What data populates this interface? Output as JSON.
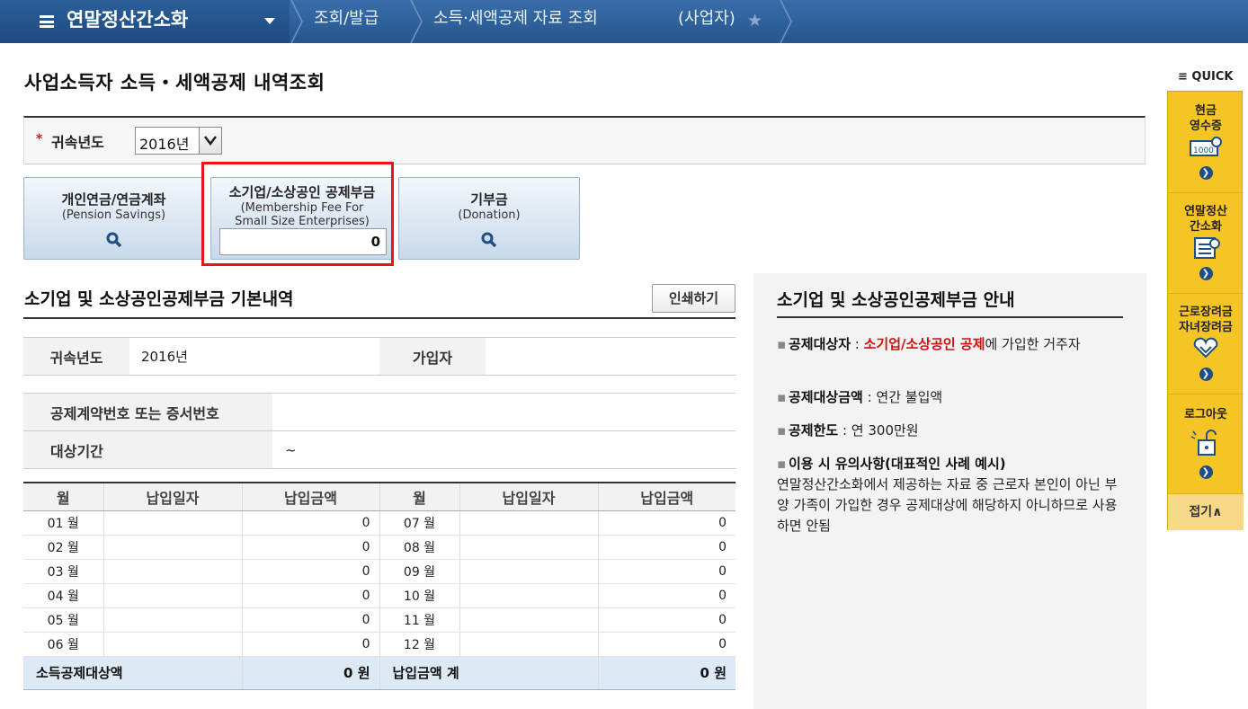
{
  "topbar": {
    "app_title": "연말정산간소화",
    "breadcrumbs": [
      "조회/발급",
      "소득·세액공제 자료 조회",
      "(사업자)"
    ]
  },
  "page_title": "사업소득자 소득・세액공제 내역조회",
  "year_filter": {
    "required_mark": "*",
    "label": "귀속년도",
    "selected": "2016년"
  },
  "categories": [
    {
      "name": "개인연금/연금계좌",
      "sub": "(Pension Savings)",
      "icon": "search-icon"
    },
    {
      "name": "소기업/소상공인 공제부금",
      "sub1": "(Membership Fee For",
      "sub2": "Small Size Enterprises)",
      "amount": "0"
    },
    {
      "name": "기부금",
      "sub": "(Donation)",
      "icon": "search-icon"
    }
  ],
  "basic_section": {
    "title": "소기업 및 소상공인공제부금 기본내역",
    "print_label": "인쇄하기",
    "info": {
      "year_label": "귀속년도",
      "year_value": "2016년",
      "subscriber_label": "가입자",
      "subscriber_value": "",
      "contract_label": "공제계약번호 또는 증서번호",
      "contract_value": "",
      "period_label": "대상기간",
      "period_value": "~"
    },
    "table": {
      "headers": [
        "월",
        "납입일자",
        "납입금액",
        "월",
        "납입일자",
        "납입금액"
      ],
      "rows": [
        {
          "m1": "01 월",
          "d1": "",
          "a1": "0",
          "m2": "07 월",
          "d2": "",
          "a2": "0"
        },
        {
          "m1": "02 월",
          "d1": "",
          "a1": "0",
          "m2": "08 월",
          "d2": "",
          "a2": "0"
        },
        {
          "m1": "03 월",
          "d1": "",
          "a1": "0",
          "m2": "09 월",
          "d2": "",
          "a2": "0"
        },
        {
          "m1": "04 월",
          "d1": "",
          "a1": "0",
          "m2": "10 월",
          "d2": "",
          "a2": "0"
        },
        {
          "m1": "05 월",
          "d1": "",
          "a1": "0",
          "m2": "11 월",
          "d2": "",
          "a2": "0"
        },
        {
          "m1": "06 월",
          "d1": "",
          "a1": "0",
          "m2": "12 월",
          "d2": "",
          "a2": "0"
        }
      ],
      "total": {
        "deduction_label": "소득공제대상액",
        "deduction_value": "0 원",
        "paid_label": "납입금액 계",
        "paid_value": "0 원"
      }
    }
  },
  "guide": {
    "title": "소기업 및 소상공인공제부금 안내",
    "items": [
      {
        "label": "공제대상자",
        "sep": " : ",
        "highlight": "소기업/소상공인 공제",
        "text": "에 가입한 거주자"
      },
      {
        "label": "공제대상금액",
        "sep": " : ",
        "text": "연간 불입액"
      },
      {
        "label": "공제한도",
        "sep": " : ",
        "text": "연 300만원"
      },
      {
        "label": "이용 시 유의사항(대표적인 사례 예시)",
        "text": "연말정산간소화에서 제공하는 자료 중 근로자 본인이 아닌 부양 가족이 가입한 경우 공제대상에 해당하지 아니하므로 사용하면 안됨"
      }
    ]
  },
  "quick": {
    "title": "QUICK",
    "items": [
      {
        "line1": "현금",
        "line2": "영수증",
        "icon": "receipt-icon"
      },
      {
        "line1": "연말정산",
        "line2": "간소화",
        "icon": "document-icon"
      },
      {
        "line1": "근로장려금",
        "line2": "자녀장려금",
        "icon": "heart-hands-icon"
      },
      {
        "line1": "로그아웃",
        "line2": "",
        "icon": "unlock-icon"
      }
    ],
    "fold_label": "접기∧"
  },
  "colors": {
    "topbar": "#25558d",
    "highlight_box": "#e8141a",
    "quick_bg": "#f5c525",
    "total_row": "#dde9f5"
  }
}
